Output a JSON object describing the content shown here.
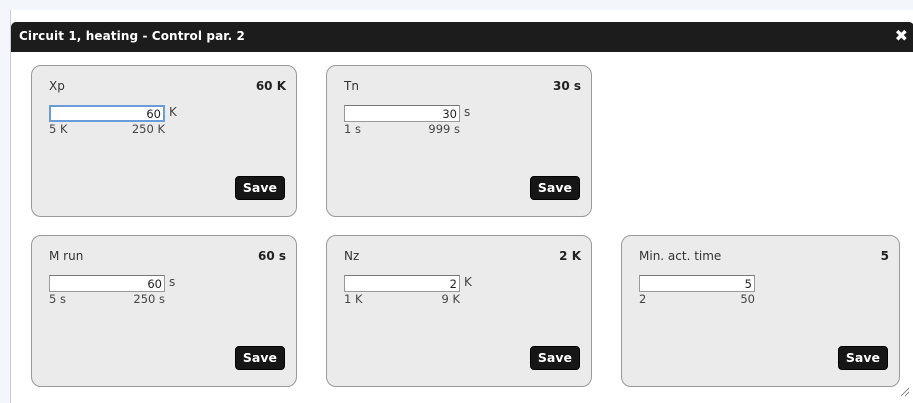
{
  "dialog": {
    "title": "Circuit 1, heating - Control par. 2",
    "close_glyph": "✖",
    "close_icon": "close-icon"
  },
  "cards": [
    {
      "label": "Xp",
      "current": "60 K",
      "value": "60",
      "unit": "K",
      "min": "5 K",
      "max": "250 K",
      "save_label": "Save"
    },
    {
      "label": "Tn",
      "current": "30 s",
      "value": "30",
      "unit": "s",
      "min": "1 s",
      "max": "999 s",
      "save_label": "Save"
    },
    {
      "label": "M run",
      "current": "60 s",
      "value": "60",
      "unit": "s",
      "min": "5 s",
      "max": "250 s",
      "save_label": "Save"
    },
    {
      "label": "Nz",
      "current": "2 K",
      "value": "2",
      "unit": "K",
      "min": "1 K",
      "max": "9 K",
      "save_label": "Save"
    },
    {
      "label": "Min. act. time",
      "current": "5",
      "value": "5",
      "unit": "",
      "min": "2",
      "max": "50",
      "save_label": "Save"
    }
  ]
}
